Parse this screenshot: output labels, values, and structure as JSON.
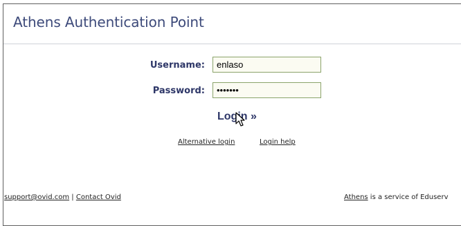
{
  "header": {
    "title": "Athens Authentication Point"
  },
  "form": {
    "username_label": "Username:",
    "username_value": "enlaso",
    "password_label": "Password:",
    "password_value": "enlasop",
    "login_label": "Login »"
  },
  "links": {
    "alternative_login": "Alternative login",
    "login_help": "Login help"
  },
  "footer": {
    "support_email": "support@ovid.com",
    "separator": "|",
    "contact": "Contact Ovid",
    "athens_link": "Athens",
    "service_text": " is a service of Eduserv"
  },
  "colors": {
    "title": "#3d4a7a",
    "label": "#2e3768",
    "field_border": "#8aa36a",
    "field_bg": "#fbfbf2"
  }
}
